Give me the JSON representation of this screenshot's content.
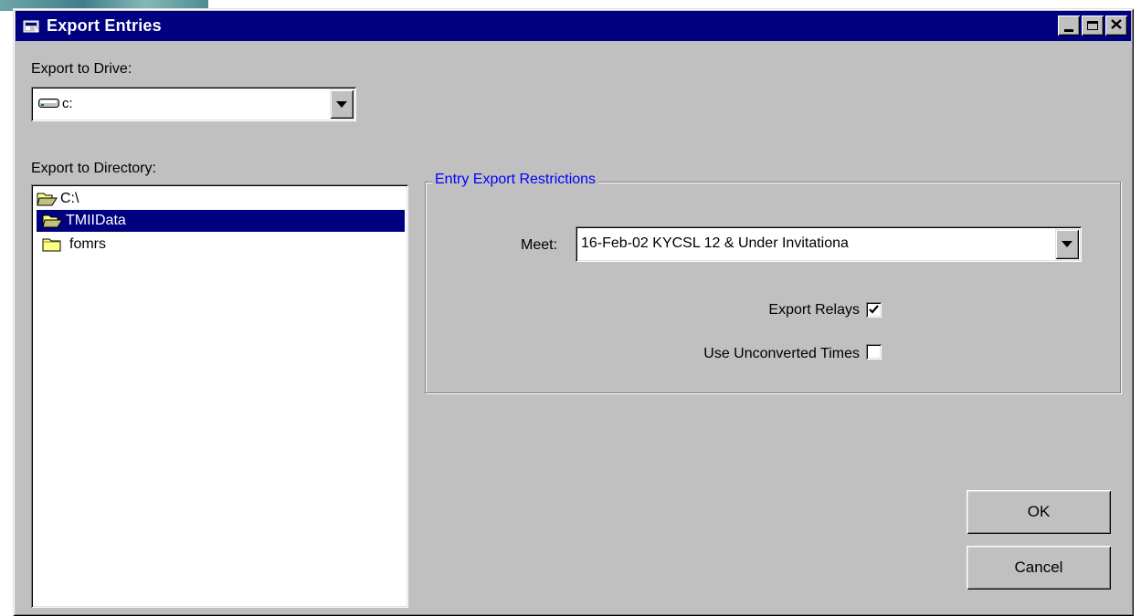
{
  "window": {
    "title": "Export Entries",
    "icon": "app-window-icon",
    "controls": [
      "minimize-icon",
      "maximize-icon",
      "close-icon"
    ]
  },
  "drive": {
    "label": "Export to Drive:",
    "value": "c:",
    "icon": "hard-drive-icon"
  },
  "directory": {
    "label": "Export to Directory:",
    "items": [
      {
        "label": "C:\\",
        "icon": "open-folder-icon",
        "selected": false
      },
      {
        "label": "TMIIData",
        "icon": "open-folder-icon",
        "selected": true
      },
      {
        "label": "fomrs",
        "icon": "closed-folder-icon",
        "selected": false
      }
    ]
  },
  "restrictions": {
    "title": "Entry Export Restrictions",
    "meet_label": "Meet:",
    "meet_value": "16-Feb-02 KYCSL  12 & Under Invitationa",
    "export_relays_label": "Export Relays",
    "export_relays_checked": true,
    "unconverted_label": "Use Unconverted Times",
    "unconverted_checked": false
  },
  "buttons": {
    "ok": "OK",
    "cancel": "Cancel"
  },
  "colors": {
    "title_bar": "#000080",
    "face": "#c0c0c0",
    "group_title": "#0000ff",
    "selection": "#000080"
  }
}
